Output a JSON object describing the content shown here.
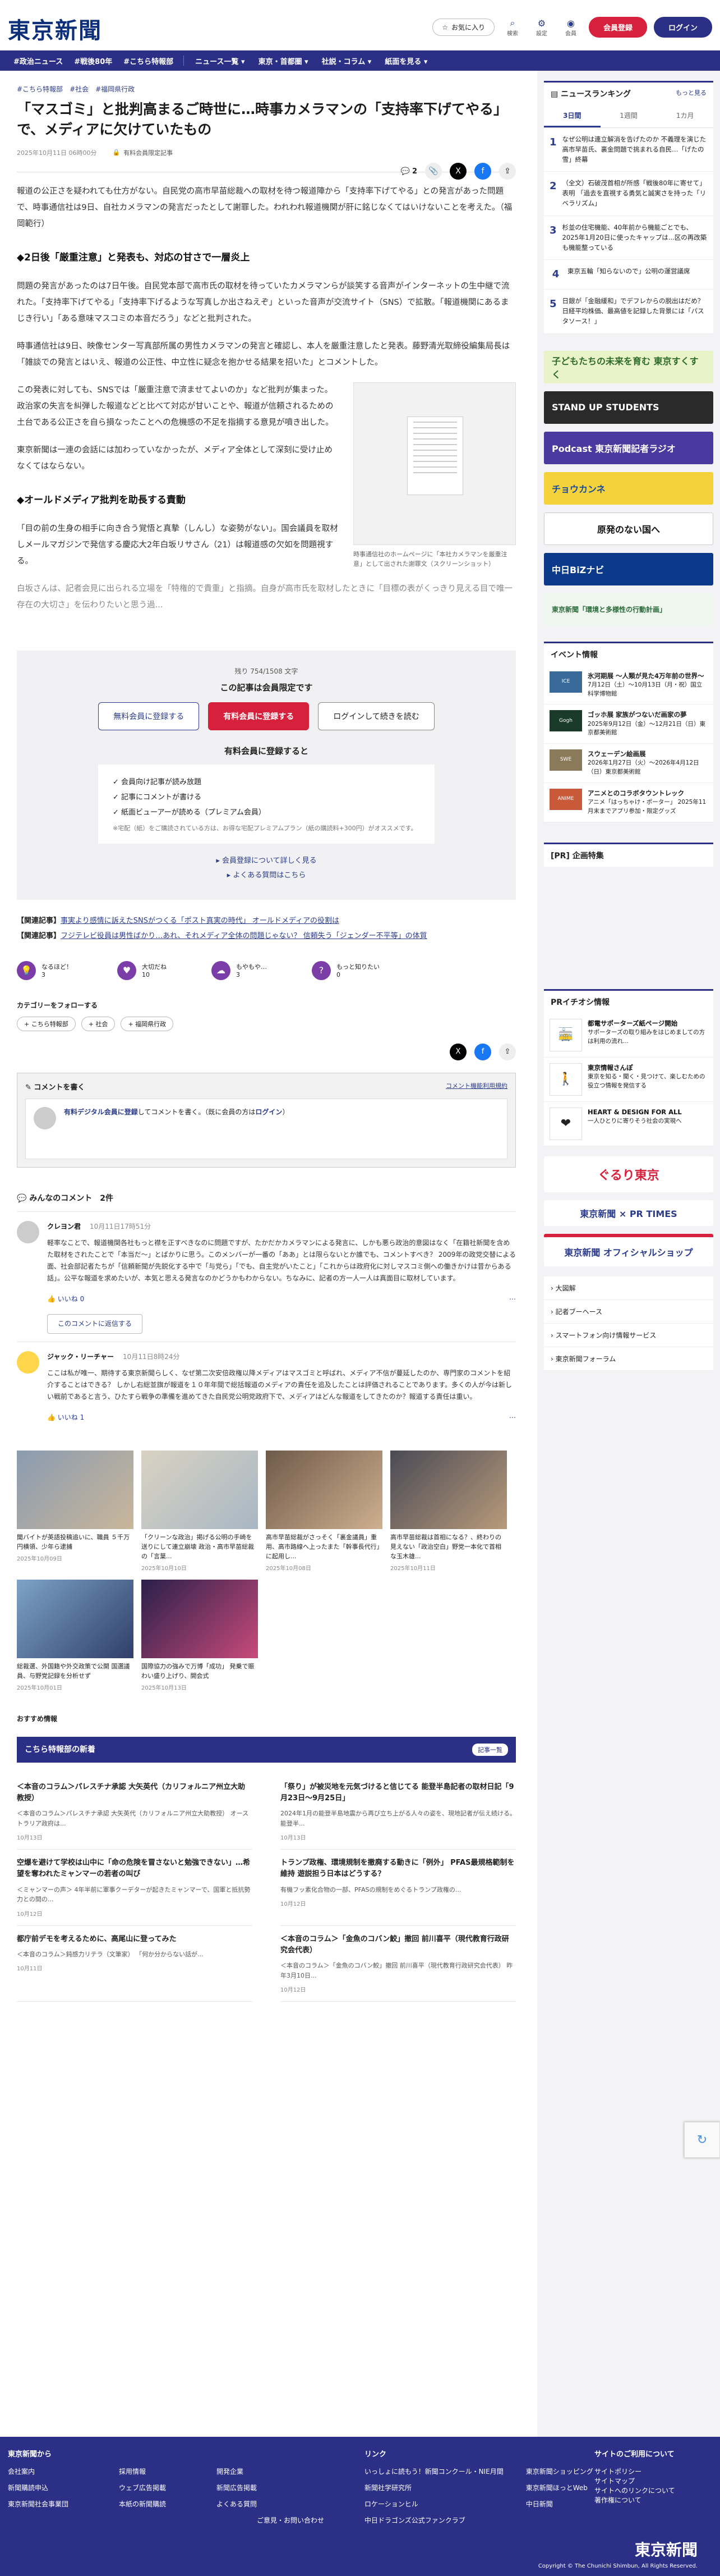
{
  "header": {
    "logo": "東京新聞",
    "favorite": "お気に入り",
    "search": "検索",
    "settings": "設定",
    "member": "会員",
    "register": "会員登録",
    "login": "ログイン"
  },
  "gnav": {
    "tags": [
      "#政治ニュース",
      "#戦後80年",
      "#こちら特報部"
    ],
    "dropdowns": [
      "ニュース一覧",
      "東京・首都圏",
      "社説・コラム",
      "紙面を見る"
    ]
  },
  "article": {
    "categories": [
      "#こちら特報部",
      "#社会",
      "#福岡県行政"
    ],
    "headline": "「マスゴミ」と批判高まるご時世に…時事カメラマンの「支持率下げてやる」で、メディアに欠けていたもの",
    "date": "2025年10月11日 06時00分",
    "paid_label": "有料会員限定記事",
    "comment_count": "2",
    "paragraphs": [
      "報道の公正さを疑われても仕方がない。自民党の高市早苗総裁への取材を待つ報道陣から「支持率下げてやる」との発言があった問題で、時事通信社は9日、自社カメラマンの発言だったとして謝罪した。われわれ報道機関が肝に銘じなくてはいけないことを考えた。（福岡範行）",
      "問題の発言があったのは7日午後。自民党本部で高市氏の取材を待っていたカメラマンらが談笑する音声がインターネットの生中継で流れた。「支持率下げてやる」「支持率下げるような写真しか出さねえぞ」といった音声が交流サイト（SNS）で拡散。「報道機関にあるまじき行い」「ある意味マスコミの本音だろう」などと批判された。",
      "時事通信社は9日、映像センター写真部所属の男性カメラマンの発言と確認し、本人を厳重注意したと発表。藤野清光取締役編集局長は「雑談での発言とはいえ、報道の公正性、中立性に疑念を抱かせる結果を招いた」とコメントした。",
      "この発表に対しても、SNSでは「厳重注意で済ませてよいのか」など批判が集まった。政治家の失言を糾弾した報道などと比べて対応が甘いことや、報道が信頼されるための土台である公正さを自ら損なったことへの危機感の不足を指摘する意見が噴き出した。",
      "東京新聞は一連の会話には加わっていなかったが、メディア全体として深刻に受け止めなくてはならない。",
      "「目の前の生身の相手に向き合う覚悟と真摯（しんし）な姿勢がない」。国会議員を取材しメールマガジンで発信する慶応大2年白坂リサさん（21）は報道感の欠如を問題視する。",
      "白坂さんは、記者会見に出られる立場を「特権的で貴重」と指摘。自身が高市氏を取材したときに「目標の表がくっきり見える目で唯一存在の大切さ」を伝わりたいと思う過..."
    ],
    "subheads": [
      "◆2日後「厳重注意」と発表も、対応の甘さで一層炎上",
      "◆オールドメディア批判を助長する責動"
    ],
    "figure_caption": "時事通信社のホームページに「本社カメラマンを厳重注意」として出された謝罪文（スクリーンショット）"
  },
  "paywall": {
    "remaining": "残り 754/1508 文字",
    "title": "この記事は会員限定です",
    "free_btn": "無料会員に登録する",
    "paid_btn": "有料会員に登録する",
    "login_btn": "ログインして続きを読む",
    "benefits_title": "有料会員に登録すると",
    "benefits": [
      "会員向け記事が読み放題",
      "記事にコメントが書ける",
      "紙面ビューアーが読める（プレミアム会員）"
    ],
    "note": "※宅配（紙）をご購読されている方は、お得な宅配プレミアムプラン（紙の購読料+300円）がオススメです。",
    "link1": "会員登録について詳しく見る",
    "link2": "よくある質問はこちら"
  },
  "related": [
    {
      "label": "【関連記事】",
      "text": "事実より感情に訴えたSNSがつくる「ポスト真実の時代」 オールドメディアの役割は"
    },
    {
      "label": "【関連記事】",
      "text": "フジテレビ役員は男性ばかり…あれ、それメディア全体の問題じゃない？ 信頼失う「ジェンダー不平等」の体質"
    }
  ],
  "reactions": [
    {
      "label": "なるほど！",
      "count": "3",
      "icon": "lightbulb-icon"
    },
    {
      "label": "大切だね",
      "count": "10",
      "icon": "heart-icon"
    },
    {
      "label": "もやもや…",
      "count": "3",
      "icon": "cloud-icon"
    },
    {
      "label": "もっと知りたい",
      "count": "0",
      "icon": "question-icon"
    }
  ],
  "follow": {
    "title": "カテゴリーをフォローする",
    "chips": [
      "+ こちら特報部",
      "+ 社会",
      "+ 福岡県行政"
    ]
  },
  "comment_box": {
    "title": "コメントを書く",
    "help": "コメント機能利用規約",
    "prompt_link": "有料デジタル会員に登録",
    "prompt_text": "してコメントを書く。（既に会員の方は",
    "prompt_login": "ログイン",
    "prompt_end": "）"
  },
  "comments": {
    "title": "みんなのコメント　2件",
    "items": [
      {
        "name": "クレヨン君",
        "date": "10月11日17時51分",
        "text": "軽率なことで、報道機関各社もっと襟を正すべきなのに問題ですが、たかだかカメラマンによる発言に、しかも悪ら政治的意図はなく「在籍社新聞を含めた取材をされたことで「本当だ～」とばかりに思う。このメンバーが一番の「ああ」とは限らないとか誰でも、コメントすべき？ 2009年の政党交替による面、社会部記者たちが「信頼新聞が先鋭化する中で「与党ら」「でも、自主党がいたこと」「これからは政府化に対しマスコミ側への働きかけは昔からある話」。公平な報道を求めたいが、本気と思える発言なのかどうかもわからない。ちなみに、記者の方一人一人は真面目に取材しています。",
        "likes": "0",
        "reply": "このコメントに返信する"
      },
      {
        "name": "ジャック・リーチャー",
        "date": "10月11日8時24分",
        "text": "ここは私が唯一、期待する東京新聞らしく、なぜ第二次安倍政権以降メディアはマスゴミと呼ばれ、メディア不信が蔓延したのか、専門家のコメントを紹介することはできる？ しかし右総並旗が報道を１０年年間で総括報道のメディアの責任を追及したことは評価されることであります。多くの人が今は新しい戦前であると言う、ひたすら戦争の準備を進めてきた自民党公明党政府下で、メディアはどんな報道をしてきたのか？報道する責任は重い。",
        "likes": "1"
      }
    ]
  },
  "photos": [
    {
      "text": "聞バイトが英語投稿追いに、職員 ５千万円横領、少年ら逮捕",
      "date": "2025年10月09日"
    },
    {
      "text": "「クリーンな政治」掲げる公明の手崎を送りにして連立崩壊 政治・高市早苗総裁の「言葉...",
      "date": "2025年10月10日"
    },
    {
      "text": "高市早苗総裁がさっそく「裏金議員」重用、高市路線へ上ったまた「幹事長代行」に起用し...",
      "date": "2025年10月08日"
    },
    {
      "text": "高市早苗総裁は首相になる？、終わりの見えない「政治空白」野党一本化で首相な玉木雄...",
      "date": "2025年10月11日"
    },
    {
      "text": "総裁選、外国籍や外交政策で公開 国選議員、与野党記録を分析せず",
      "date": "2025年10月01日"
    },
    {
      "text": "国際協力の強みで万博「成功」 発乗で賑わい盛り上げり、開会式",
      "date": "2025年10月13日"
    }
  ],
  "recommend_title": "おすすめ情報",
  "tokuho": {
    "title": "こちら特報部の新着",
    "more": "記事一覧",
    "items": [
      {
        "title": "＜本音のコラム＞パレスチナ承認 大矢英代（カリフォルニア州立大助教授）",
        "desc": "＜本音のコラム＞パレスチナ承認 大矢英代（カリフォルニア州立大助教授） オーストラリア政府は...",
        "date": "10月13日"
      },
      {
        "title": "「祭り」が被災地を元気づけると信じてる 能登半島記者の取材日記「9月23日〜9月25日」",
        "desc": "2024年1月の能登半島地震から再び立ち上がる人々の姿を、現地記者が伝え続ける。能登半...",
        "date": "10月13日"
      },
      {
        "title": "空爆を避けて学校は山中に「命の危険を冒さないと勉強できない」…希望を奪われたミャンマーの若者の叫び",
        "desc": "＜ミャンマーの声＞ 4年半前に軍事クーデターが起きたミャンマーで、国軍と抵抗勢力との間の...",
        "date": "10月12日"
      },
      {
        "title": "トランプ政権、環境規制を撤廃する動きに「例外」 PFAS最規格範制を維持 遊説担う日本はどうする？",
        "desc": "有機フッ素化合物の一部、PFASの規制をめぐるトランプ政権の...",
        "date": "10月12日"
      },
      {
        "title": "都庁前デモを考えるために、高尾山に登ってみた",
        "desc": "＜本音のコラム＞鈍感力リテラ（文筆家） 「何か分からない話が...",
        "date": "10月11日"
      },
      {
        "title": "＜本音のコラム＞「金魚のコバン鮫」撤回 前川喜平（現代教育行政研究会代表）",
        "desc": "＜本音のコラム＞「金魚のコバン鮫」撤回 前川喜平（現代教育行政研究会代表） 昨年3月10日...",
        "date": "10月12日"
      }
    ]
  },
  "sidebar": {
    "ranking_title": "ニュースランキング",
    "ranking_more": "もっと見る",
    "tabs": [
      "3日間",
      "1週間",
      "1カ月"
    ],
    "ranking": [
      {
        "n": "1",
        "text": "なぜ公明は連立解消を告げたのか 不義理を演じた高市早苗氏、裏金問題で挑まれる自民…「げたの雪」終幕"
      },
      {
        "n": "2",
        "text": "（全文）石破茂首相が所感「戦後80年に寄せて」表明 「過去を直視する勇気と誠実さを持った「リベラリズム」"
      },
      {
        "n": "3",
        "text": "杉並の住宅機能、40年前から機能ごとでも、2025年1月20日に使ったキャップは...区の再改築も機能整っている"
      },
      {
        "n": "4",
        "text": "東京五輪「知らないので」公明の運営議席"
      },
      {
        "n": "5",
        "text": "日銀が「金融緩和」でデフレからの脱出はだめ？ 日経平均株価、最高値を記録した背景には「パスタソース！」"
      }
    ],
    "banners": [
      {
        "text": "子どもたちの未来を育む 東京すくすく",
        "bg": "#e8f3c8"
      },
      {
        "text": "STAND UP STUDENTS",
        "bg": "#2a2a2a"
      },
      {
        "text": "Podcast 東京新聞記者ラジオ",
        "bg": "#4a3aa0"
      },
      {
        "text": "チョウカンネ",
        "bg": "#f4d23b"
      },
      {
        "text": "原発のない国へ",
        "bg": "#ffffff"
      },
      {
        "text": "中日BiZナビ",
        "bg": "#0b3a8a"
      },
      {
        "text": "東京新聞「環境と多様性の行動計画」",
        "bg": "#eef6ee"
      }
    ],
    "events_title": "イベント情報",
    "events": [
      {
        "title": "氷河期展 〜人類が見た4万年前の世界〜",
        "desc": "7月12日（土）〜10月13日（月・祝）国立科学博物館",
        "img": "ICE"
      },
      {
        "title": "ゴッホ展 家族がつないだ画家の夢",
        "desc": "2025年9月12日（金）〜12月21日（日）東京都美術館",
        "img": "Gogh"
      },
      {
        "title": "スウェーデン絵画展",
        "desc": "2026年1月27日（火）〜2026年4月12日（日）東京都美術館",
        "img": "SWE"
      },
      {
        "title": "アニメとのコラボタウントレック",
        "desc": "アニメ「はっちゃけ・ポーター」 2025年11月末までアプリ参加・限定グッズ",
        "img": "ANIME"
      }
    ],
    "pr_title": "[PR] 企画特集",
    "pr_info_title": "PRイチオシ情報",
    "pr": [
      {
        "title": "都電サポーターズ紙ページ開始",
        "desc": "サポーターズの取り組みをはじめましての方は利用の流れ...",
        "icon": "train-icon"
      },
      {
        "title": "東京情報さんぽ",
        "desc": "東京を知る・聞く・見つけて、楽しむための役立つ情報を発信する",
        "icon": "walk-icon"
      },
      {
        "title": "HEART & DESIGN FOR ALL",
        "desc": "一人ひとりに寄りそう社会の実現へ",
        "icon": "heart-icon"
      }
    ],
    "pr_banners": [
      "ぐるり東京",
      "東京新聞 × PR TIMES",
      "東京新聞 オフィシャルショップ"
    ],
    "links": [
      "大図解",
      "記者ブーヘース",
      "スマートフォン向け情報サービス",
      "東京新聞フォーラム"
    ]
  },
  "footer": {
    "col1_title": "東京新聞から",
    "col1": [
      [
        "会社案内",
        "新聞購読申込",
        "東京新聞社会事業団"
      ],
      [
        "採用情報",
        "ウェブ広告掲載",
        "本紙の新聞購読"
      ],
      [
        "開発企業",
        "新聞広告掲載",
        "よくある質問"
      ]
    ],
    "col1_extra": [
      "ご意見・お問い合わせ"
    ],
    "col2_title": "リンク",
    "col2": [
      "いっしょに読もう！新聞コンクール・NIE月間",
      "新聞社学研究所",
      "ロケーションヒル",
      "中日ドラゴンズ公式ファンクラブ"
    ],
    "col2_b": [
      "東京新聞ショッピング",
      "東京新聞ほっとWeb",
      "中日新聞"
    ],
    "col3_title": "サイトのご利用について",
    "col3": [
      "サイトポリシー",
      "サイトマップ",
      "サイトへのリンクについて",
      "著作権について"
    ],
    "logo": "東京新聞",
    "copyright": "Copyright © The Chunichi Shimbun, All Rights Reserved."
  }
}
